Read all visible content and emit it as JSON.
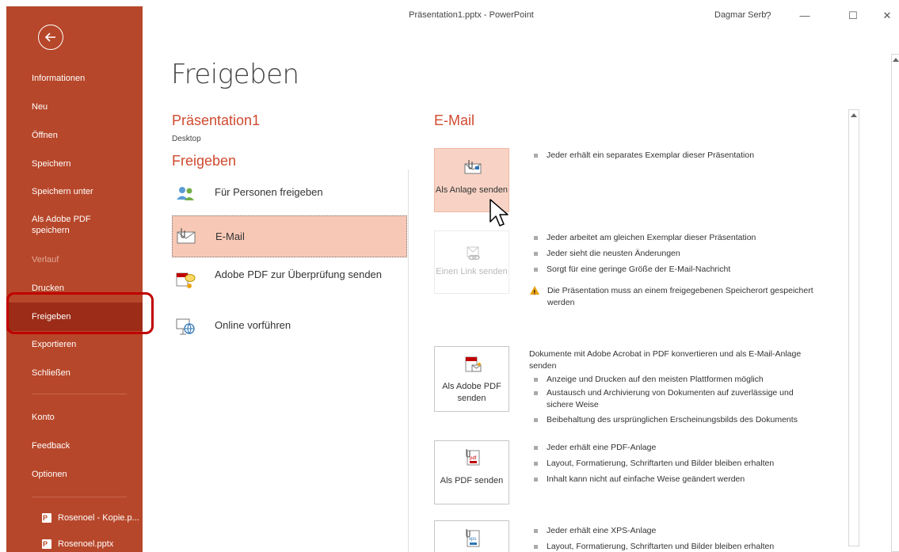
{
  "window": {
    "title": "Präsentation1.pptx - PowerPoint",
    "user": "Dagmar Serb",
    "help": "?",
    "minimize": "—",
    "maximize": "☐",
    "close": "✕"
  },
  "sidebar": {
    "items": [
      {
        "label": "Informationen"
      },
      {
        "label": "Neu"
      },
      {
        "label": "Öffnen"
      },
      {
        "label": "Speichern"
      },
      {
        "label": "Speichern unter"
      },
      {
        "label": "Als Adobe PDF speichern"
      },
      {
        "label": "Verlauf"
      },
      {
        "label": "Drucken"
      },
      {
        "label": "Freigeben"
      },
      {
        "label": "Exportieren"
      },
      {
        "label": "Schließen"
      },
      {
        "label": "Konto"
      },
      {
        "label": "Feedback"
      },
      {
        "label": "Optionen"
      }
    ],
    "recent": [
      {
        "label": "Rosenoel - Kopie.p..."
      },
      {
        "label": "Rosenoel.pptx"
      }
    ],
    "accent_color": "#b7472a",
    "highlight_color": "#c00000"
  },
  "main": {
    "title": "Freigeben",
    "document": {
      "name": "Präsentation1",
      "location": "Desktop"
    },
    "share_header": "Freigeben",
    "share_options": [
      {
        "label": "Für Personen freigeben",
        "icon": "people-icon"
      },
      {
        "label": "E-Mail",
        "icon": "email-icon",
        "selected": true
      },
      {
        "label": "Adobe PDF zur Überprüfung senden",
        "icon": "pdf-review-icon"
      },
      {
        "label": "Online vorführen",
        "icon": "present-online-icon"
      }
    ]
  },
  "email_panel": {
    "header": "E-Mail",
    "attach": {
      "button": "Als Anlage senden",
      "bullets": [
        "Jeder erhält ein separates Exemplar dieser Präsentation"
      ]
    },
    "link": {
      "button": "Einen Link senden",
      "bullets": [
        "Jeder arbeitet am gleichen Exemplar dieser Präsentation",
        "Jeder sieht die neusten Änderungen",
        "Sorgt für eine geringe Größe der E-Mail-Nachricht"
      ],
      "warning": "Die Präsentation muss an einem freigegebenen Speicherort gespeichert werden"
    },
    "adobe_pdf": {
      "button": "Als Adobe PDF senden",
      "intro": "Dokumente mit Adobe Acrobat in PDF konvertieren und als E-Mail-Anlage senden",
      "bullets": [
        "Anzeige und Drucken auf den meisten Plattformen möglich",
        "Austausch und Archivierung von Dokumenten auf zuverlässige und sichere Weise",
        "Beibehaltung des ursprünglichen Erscheinungsbilds des Dokuments"
      ]
    },
    "pdf": {
      "button": "Als PDF senden",
      "bullets": [
        "Jeder erhält eine PDF-Anlage",
        "Layout, Formatierung, Schriftarten und Bilder bleiben erhalten",
        "Inhalt kann nicht auf einfache Weise geändert werden"
      ]
    },
    "xps": {
      "bullets": [
        "Jeder erhält eine XPS-Anlage",
        "Layout, Formatierung, Schriftarten und Bilder bleiben erhalten"
      ]
    }
  }
}
